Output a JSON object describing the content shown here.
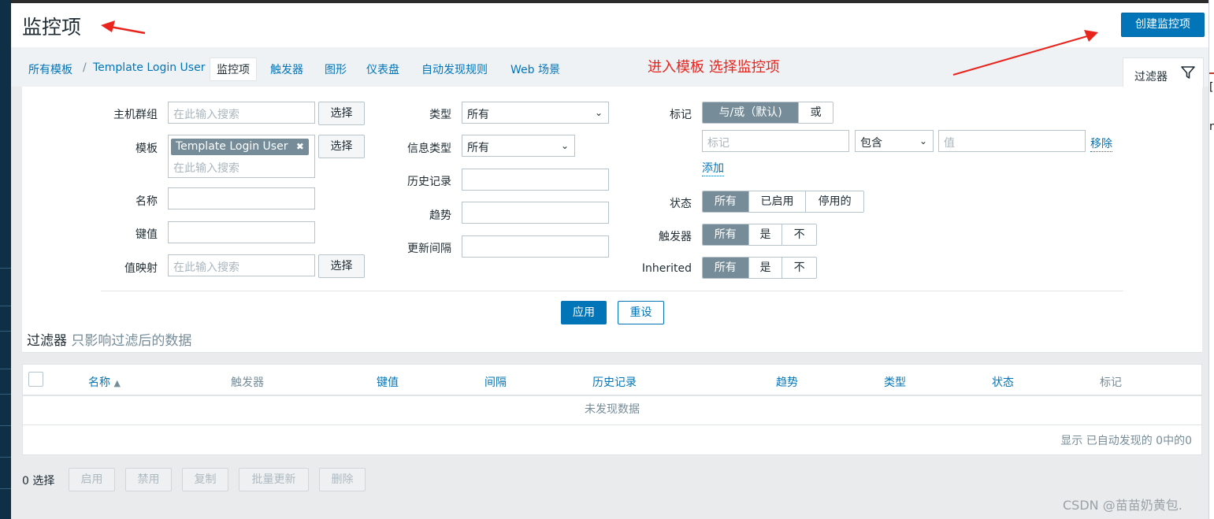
{
  "page": {
    "title": "监控项",
    "create_button": "创建监控项",
    "annotation": "进入模板 选择监控项"
  },
  "breadcrumb": {
    "all_templates": "所有模板",
    "separator": "/",
    "template": "Template Login User"
  },
  "tabs": [
    "监控项",
    "触发器",
    "图形",
    "仪表盘",
    "自动发现规则",
    "Web 场景"
  ],
  "filter_tab": {
    "label": "过滤器",
    "icon": "filter-icon"
  },
  "filter": {
    "host_group": {
      "label": "主机群组",
      "placeholder": "在此输入搜索",
      "button": "选择"
    },
    "template": {
      "label": "模板",
      "tag": "Template Login User",
      "tag_close": "✖",
      "placeholder": "在此输入搜索",
      "button": "选择"
    },
    "name": {
      "label": "名称",
      "value": ""
    },
    "key": {
      "label": "键值",
      "value": ""
    },
    "value_map": {
      "label": "值映射",
      "placeholder": "在此输入搜索",
      "button": "选择"
    },
    "type": {
      "label": "类型",
      "value": "所有"
    },
    "info_type": {
      "label": "信息类型",
      "value": "所有"
    },
    "history": {
      "label": "历史记录",
      "value": ""
    },
    "trends": {
      "label": "趋势",
      "value": ""
    },
    "update_interval": {
      "label": "更新间隔",
      "value": ""
    },
    "tags": {
      "label": "标记",
      "modes": [
        "与/或（默认)",
        "或"
      ],
      "tag_placeholder": "标记",
      "operator": "包含",
      "value_placeholder": "值",
      "remove": "移除",
      "add": "添加"
    },
    "status": {
      "label": "状态",
      "options": [
        "所有",
        "已启用",
        "停用的"
      ]
    },
    "triggers": {
      "label": "触发器",
      "options": [
        "所有",
        "是",
        "不"
      ]
    },
    "inherited": {
      "label": "Inherited",
      "options": [
        "所有",
        "是",
        "不"
      ]
    },
    "apply": "应用",
    "reset": "重设",
    "note_title": "过滤器",
    "note_sub": "只影响过滤后的数据"
  },
  "table": {
    "columns": [
      "名称",
      "触发器",
      "键值",
      "间隔",
      "历史记录",
      "趋势",
      "类型",
      "状态",
      "标记"
    ],
    "sort_indicator": "▲",
    "empty": "未发现数据",
    "summary": "显示 已自动发现的 0中的0"
  },
  "actions": {
    "selected": "0 选择",
    "buttons": [
      "启用",
      "禁用",
      "复制",
      "批量更新",
      "删除"
    ]
  },
  "watermark": "CSDN @苗苗奶黄包.",
  "colors": {
    "accent": "#0275b8",
    "annotation": "#e8241d",
    "segment_on": "#768d99"
  }
}
